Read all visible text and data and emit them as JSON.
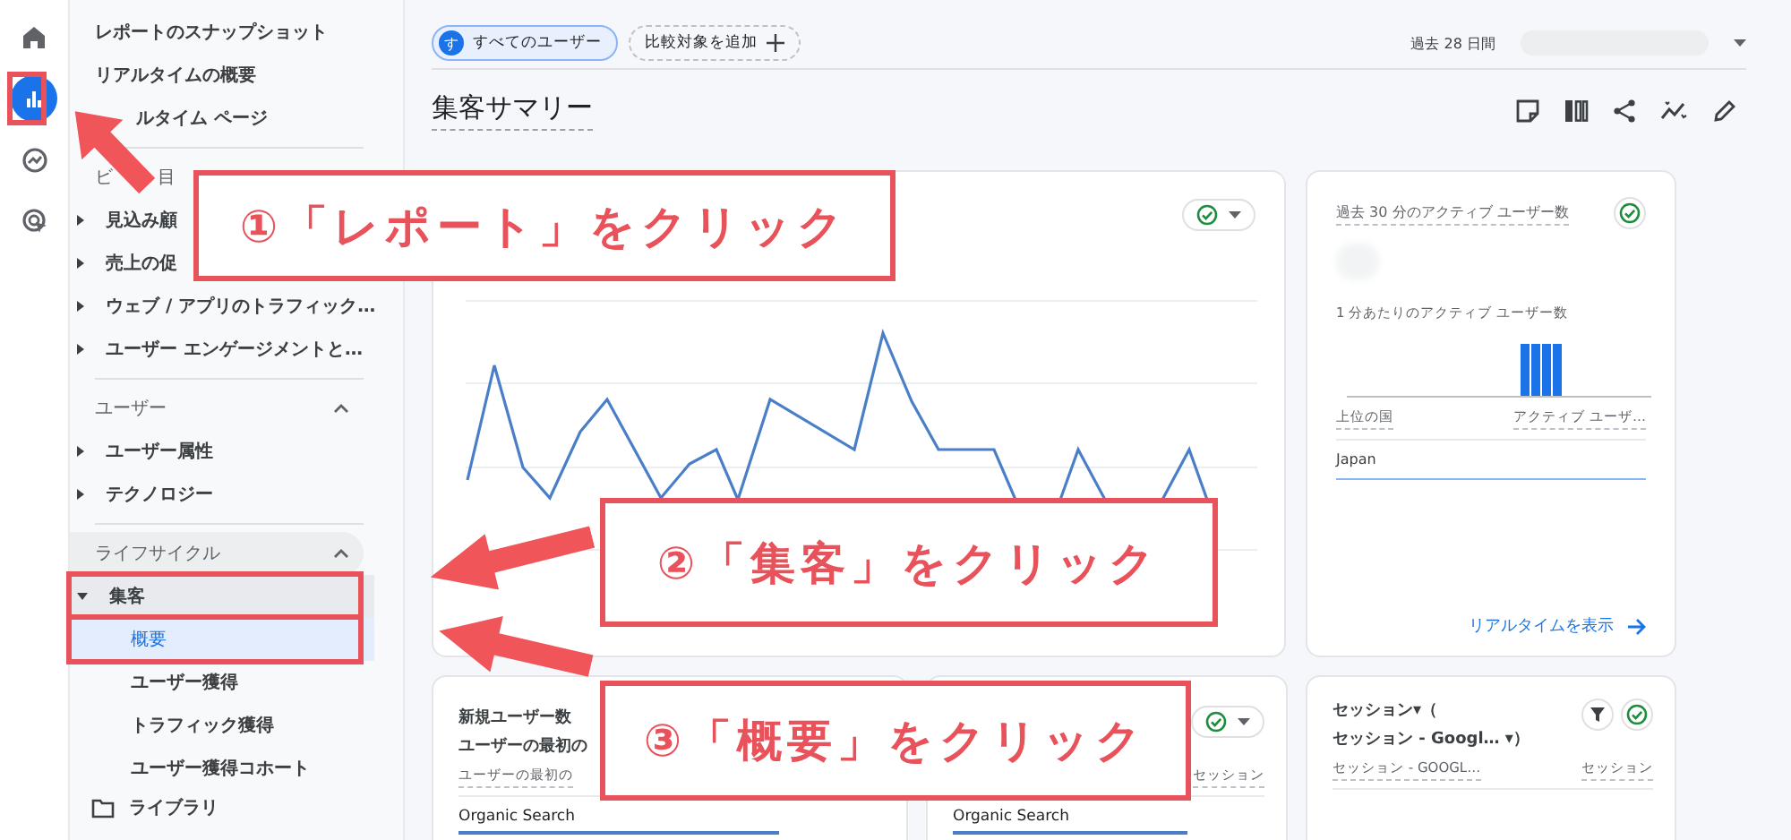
{
  "rail": [
    {
      "kind": "home",
      "selected": false
    },
    {
      "kind": "reports",
      "selected": true
    },
    {
      "kind": "explore",
      "selected": false
    },
    {
      "kind": "advertising",
      "selected": false
    }
  ],
  "sidebar": {
    "links": [
      {
        "label": "レポートのスナップショット"
      },
      {
        "label": "リアルタイムの概要"
      },
      {
        "label": "ルタイム ページ"
      }
    ],
    "sections": [
      {
        "title_parts": [
          "ビ",
          "目"
        ],
        "highlighted": false,
        "items": [
          {
            "label": "見込み顧",
            "expanded": false
          },
          {
            "label": "売上の促",
            "expanded": false
          },
          {
            "label": "ウェブ / アプリのトラフィック…",
            "expanded": false
          },
          {
            "label": "ユーザー エンゲージメントと…",
            "expanded": false
          }
        ]
      },
      {
        "title_parts": [
          "ユーザー"
        ],
        "expanded": true,
        "highlighted": false,
        "items": [
          {
            "label": "ユーザー属性",
            "expanded": false
          },
          {
            "label": "テクノロジー",
            "expanded": false
          }
        ]
      },
      {
        "title_parts": [
          "ライフサイクル"
        ],
        "expanded": true,
        "highlighted": true,
        "items": [
          {
            "label": "集客",
            "expanded": true,
            "children": [
              {
                "label": "概要",
                "selected": true
              },
              {
                "label": "ユーザー獲得",
                "selected": false
              },
              {
                "label": "トラフィック獲得",
                "selected": false
              },
              {
                "label": "ユーザー獲得コホート",
                "selected": false
              }
            ]
          }
        ]
      }
    ],
    "footer": "ライブラリ"
  },
  "toolbar": {
    "segment": {
      "initial": "す",
      "label": "すべてのユーザー"
    },
    "add_comparison": "比較対象を追加",
    "date_range": "過去 28 日間"
  },
  "title": "集客サマリー",
  "realtime_card": {
    "title": "過去 30 分のアクティブ ユーザー数",
    "per_minute_label": "1 分あたりのアクティブ ユーザー数",
    "columns": [
      "上位の国",
      "アクティブ ユーザ…"
    ],
    "rows": [
      "Japan"
    ],
    "link": "リアルタイムを表示"
  },
  "bottom_cards": [
    {
      "kind": "users",
      "title_lines": [
        "新規ユーザー数",
        "ユーザーの最初の"
      ],
      "columns": [
        "ユーザーの最初の"
      ],
      "rows": [
        "Organic Search"
      ]
    },
    {
      "kind": "sessions_partial",
      "columns": [
        "セッション"
      ],
      "rows": [
        "Organic Search"
      ]
    },
    {
      "kind": "sessions",
      "title_lines": [
        "セッション▾（",
        "セッション - Googl… ▾）"
      ],
      "columns": [
        "セッション - GOOGL…",
        "セッション"
      ]
    }
  ],
  "callouts": [
    {
      "text": "①「レポート」をクリック"
    },
    {
      "text": "②「集客」をクリック"
    },
    {
      "text": "③「概要」をクリック"
    }
  ]
}
